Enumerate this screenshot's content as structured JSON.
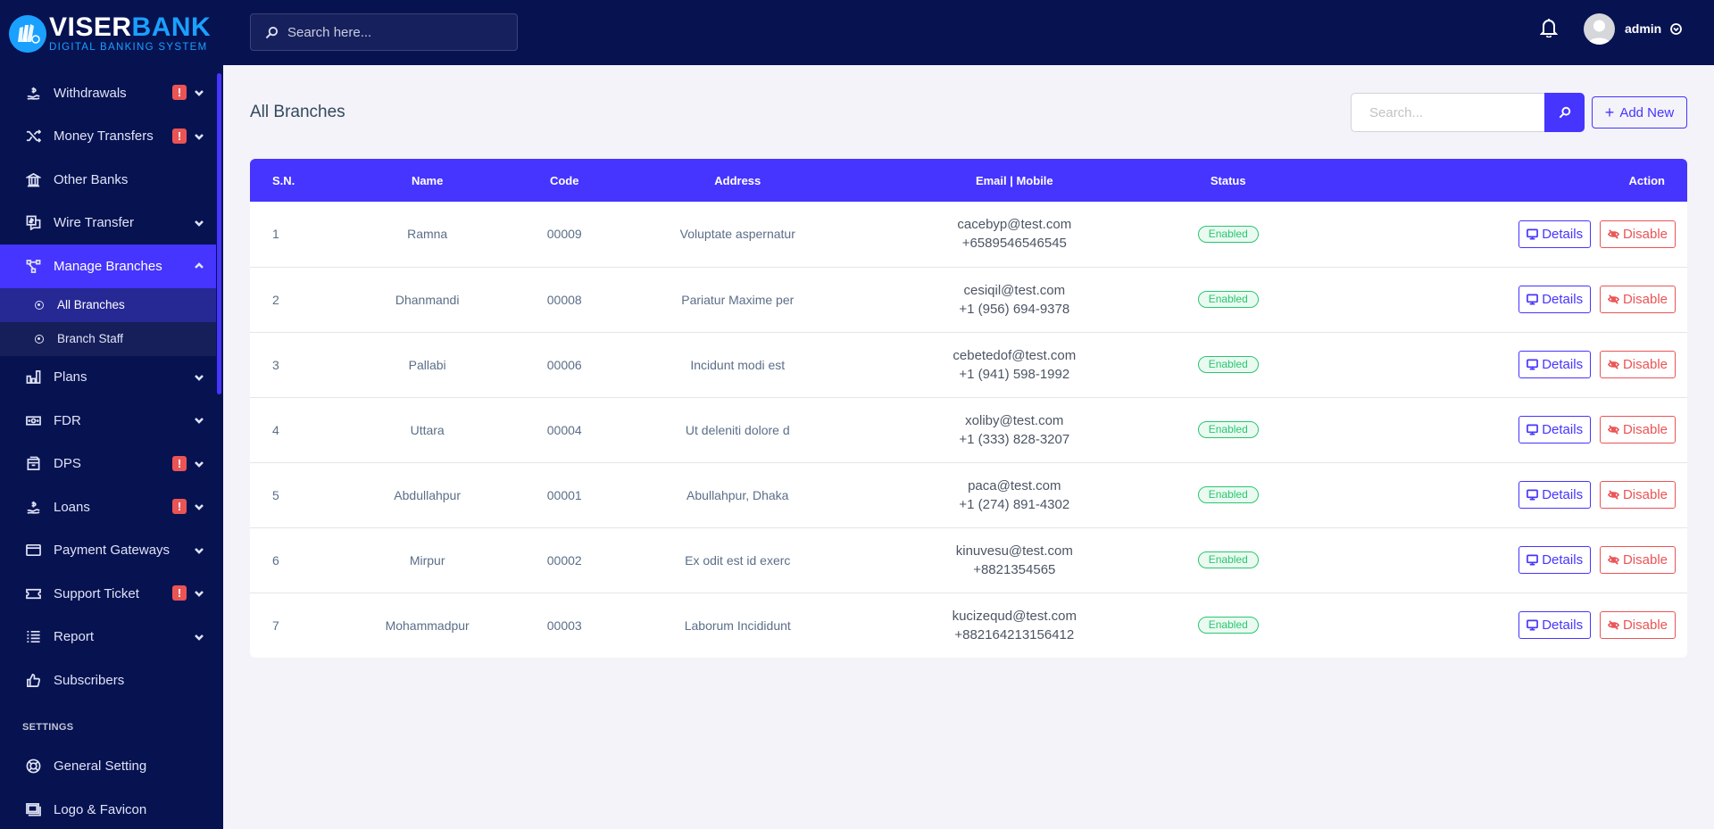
{
  "brand": {
    "title_white": "VISER",
    "title_blue": "BANK",
    "subtitle": "DIGITAL BANKING SYSTEM",
    "colors": {
      "sidebar_bg": "#071251",
      "accent": "#4634ff",
      "danger": "#ea5455",
      "success": "#28c76f",
      "logo_blue": "#1aa0ff"
    }
  },
  "sidebar": {
    "items": [
      {
        "label": "Withdrawals",
        "icon": "hand-dollar-icon",
        "badge": "!",
        "has_chevron": true
      },
      {
        "label": "Money Transfers",
        "icon": "shuffle-icon",
        "badge": "!",
        "has_chevron": true
      },
      {
        "label": "Other Banks",
        "icon": "bank-icon",
        "has_chevron": false
      },
      {
        "label": "Wire Transfer",
        "icon": "transfer-chat-icon",
        "has_chevron": true
      },
      {
        "label": "Manage Branches",
        "icon": "network-icon",
        "has_chevron": true,
        "expanded": true,
        "active": true,
        "children": [
          {
            "label": "All Branches",
            "active": true
          },
          {
            "label": "Branch Staff",
            "active": false
          }
        ]
      },
      {
        "label": "Plans",
        "icon": "bar-chart-icon",
        "has_chevron": true
      },
      {
        "label": "FDR",
        "icon": "money-bill-icon",
        "has_chevron": true
      },
      {
        "label": "DPS",
        "icon": "box-icon",
        "badge": "!",
        "has_chevron": true
      },
      {
        "label": "Loans",
        "icon": "hand-dollar-icon",
        "badge": "!",
        "has_chevron": true
      },
      {
        "label": "Payment Gateways",
        "icon": "credit-card-icon",
        "has_chevron": true
      },
      {
        "label": "Support Ticket",
        "icon": "ticket-icon",
        "badge": "!",
        "has_chevron": true
      },
      {
        "label": "Report",
        "icon": "list-icon",
        "has_chevron": true
      },
      {
        "label": "Subscribers",
        "icon": "thumbs-up-icon",
        "has_chevron": false
      }
    ],
    "settings_heading": "SETTINGS",
    "settings_items": [
      {
        "label": "General Setting",
        "icon": "life-ring-icon"
      },
      {
        "label": "Logo & Favicon",
        "icon": "images-icon"
      }
    ]
  },
  "topbar": {
    "search_placeholder": "Search here...",
    "user_name": "admin"
  },
  "page": {
    "title": "All Branches",
    "search_placeholder": "Search...",
    "add_new_label": "Add New"
  },
  "table": {
    "columns": [
      "S.N.",
      "Name",
      "Code",
      "Address",
      "Email | Mobile",
      "Status",
      "Action"
    ],
    "details_label": "Details",
    "disable_label": "Disable",
    "rows": [
      {
        "sn": "1",
        "name": "Ramna",
        "code": "00009",
        "address": "Voluptate aspernatur",
        "email": "cacebyp@test.com",
        "mobile": "+6589546546545",
        "status": "Enabled"
      },
      {
        "sn": "2",
        "name": "Dhanmandi",
        "code": "00008",
        "address": "Pariatur Maxime per",
        "email": "cesiqil@test.com",
        "mobile": "+1 (956) 694-9378",
        "status": "Enabled"
      },
      {
        "sn": "3",
        "name": "Pallabi",
        "code": "00006",
        "address": "Incidunt modi est",
        "email": "cebetedof@test.com",
        "mobile": "+1 (941) 598-1992",
        "status": "Enabled"
      },
      {
        "sn": "4",
        "name": "Uttara",
        "code": "00004",
        "address": "Ut deleniti dolore d",
        "email": "xoliby@test.com",
        "mobile": "+1 (333) 828-3207",
        "status": "Enabled"
      },
      {
        "sn": "5",
        "name": "Abdullahpur",
        "code": "00001",
        "address": "Abullahpur, Dhaka",
        "email": "paca@test.com",
        "mobile": "+1 (274) 891-4302",
        "status": "Enabled"
      },
      {
        "sn": "6",
        "name": "Mirpur",
        "code": "00002",
        "address": "Ex odit est id exerc",
        "email": "kinuvesu@test.com",
        "mobile": "+8821354565",
        "status": "Enabled"
      },
      {
        "sn": "7",
        "name": "Mohammadpur",
        "code": "00003",
        "address": "Laborum Incididunt",
        "email": "kucizequd@test.com",
        "mobile": "+882164213156412",
        "status": "Enabled"
      }
    ]
  }
}
